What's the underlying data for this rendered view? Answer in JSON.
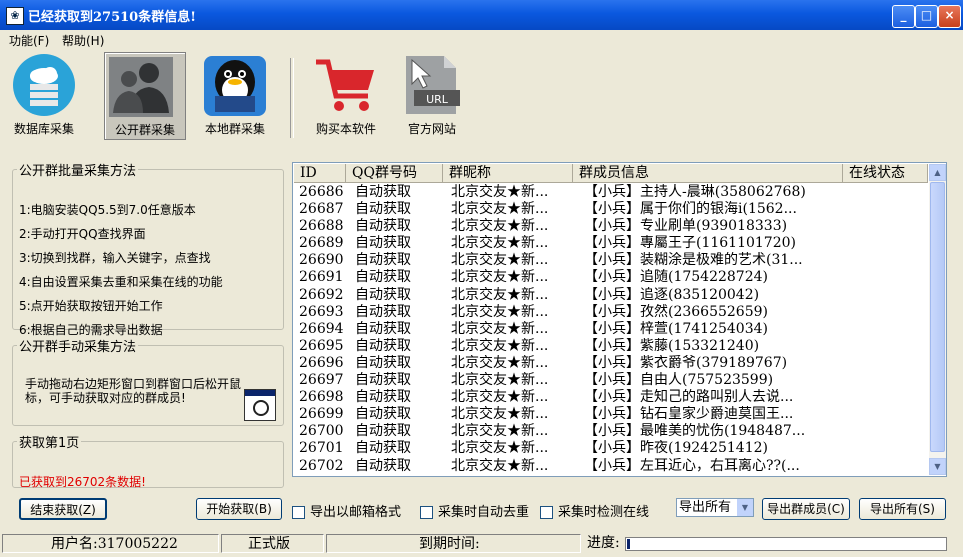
{
  "window": {
    "title": "已经获取到27510条群信息!"
  },
  "menu": [
    "功能(F)",
    "帮助(H)"
  ],
  "toolbar": {
    "items": [
      {
        "id": "db",
        "label": "数据库采集",
        "icon": "database-cloud-icon"
      },
      {
        "id": "public",
        "label": "公开群采集",
        "icon": "user-group-icon",
        "active": true
      },
      {
        "id": "local",
        "label": "本地群采集",
        "icon": "qq-penguin-icon"
      },
      {
        "id": "buy",
        "label": "购买本软件",
        "icon": "shopping-cart-icon"
      },
      {
        "id": "site",
        "label": "官方网站",
        "icon": "url-file-icon"
      }
    ]
  },
  "left": {
    "batch_title": "公开群批量采集方法",
    "steps": [
      "1:电脑安装QQ5.5到7.0任意版本",
      "2:手动打开QQ查找界面",
      "3:切换到找群，输入关键字，点查找",
      "4:自由设置采集去重和采集在线的功能",
      "5:点开始获取按钮开始工作",
      "6:根据自己的需求导出数据"
    ],
    "manual_title": "公开群手动采集方法",
    "manual_text": "手动拖动右边矩形窗口到群窗口后松开鼠标，可手动获取对应的群成员!",
    "fetch_title": "获取第1页",
    "fetch_status": "已获取到26702条数据!"
  },
  "table": {
    "columns": [
      "ID",
      "QQ群号码",
      "群昵称",
      "群成员信息",
      "在线状态"
    ],
    "rows": [
      [
        "26686",
        "自动获取",
        "北京交友★新...",
        "【小兵】主持人-晨琳(358062768)"
      ],
      [
        "26687",
        "自动获取",
        "北京交友★新...",
        "【小兵】属于你们的银海i(1562..."
      ],
      [
        "26688",
        "自动获取",
        "北京交友★新...",
        "【小兵】专业刷单(939018333)"
      ],
      [
        "26689",
        "自动获取",
        "北京交友★新...",
        "【小兵】專屬王子(1161101720)"
      ],
      [
        "26690",
        "自动获取",
        "北京交友★新...",
        "【小兵】装糊涂是极难的艺术(31..."
      ],
      [
        "26691",
        "自动获取",
        "北京交友★新...",
        "【小兵】追随(1754228724)"
      ],
      [
        "26692",
        "自动获取",
        "北京交友★新...",
        "【小兵】追逐(835120042)"
      ],
      [
        "26693",
        "自动获取",
        "北京交友★新...",
        "【小兵】孜然(2366552659)"
      ],
      [
        "26694",
        "自动获取",
        "北京交友★新...",
        "【小兵】梓萱(1741254034)"
      ],
      [
        "26695",
        "自动获取",
        "北京交友★新...",
        "【小兵】紫藤(153321240)"
      ],
      [
        "26696",
        "自动获取",
        "北京交友★新...",
        "【小兵】紫衣爵爷(379189767)"
      ],
      [
        "26697",
        "自动获取",
        "北京交友★新...",
        "【小兵】自由人(757523599)"
      ],
      [
        "26698",
        "自动获取",
        "北京交友★新...",
        "【小兵】走知己的路叫别人去说..."
      ],
      [
        "26699",
        "自动获取",
        "北京交友★新...",
        "【小兵】钻石皇家少爵迪莫国王..."
      ],
      [
        "26700",
        "自动获取",
        "北京交友★新...",
        "【小兵】最唯美的忧伤(1948487..."
      ],
      [
        "26701",
        "自动获取",
        "北京交友★新...",
        "【小兵】昨夜(1924251412)"
      ],
      [
        "26702",
        "自动获取",
        "北京交友★新...",
        "【小兵】左耳近心，右耳离心??(..."
      ]
    ]
  },
  "controls": {
    "stop_label": "结束获取(Z)",
    "start_label": "开始获取(B)",
    "chk_email": "导出以邮箱格式",
    "chk_dedupe": "采集时自动去重",
    "chk_online": "采集时检测在线",
    "export_option": "导出所有",
    "export_members_label": "导出群成员(C)",
    "export_all_label": "导出所有(S)"
  },
  "statusbar": {
    "user": "用户名:317005222",
    "edition": "正式版",
    "expire": "到期时间:",
    "progress_label": "进度:",
    "progress": 0.01
  },
  "colors": {
    "title_blue": "#0a58df",
    "status_red": "#e00000"
  }
}
